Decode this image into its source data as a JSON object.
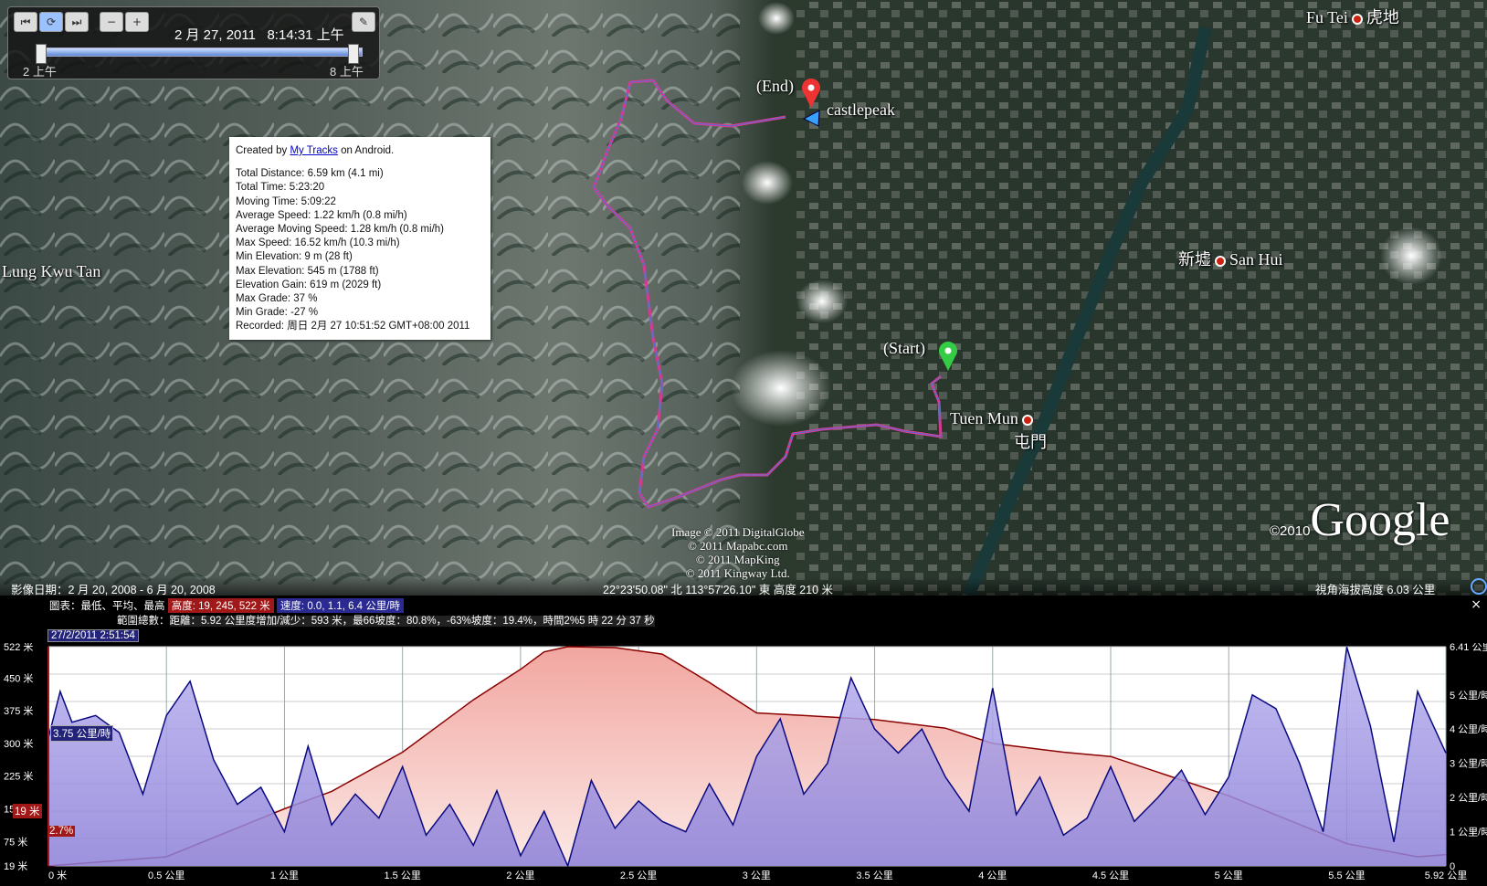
{
  "player": {
    "date_text": "2 月 27, 2011",
    "time_text": "8:14:31 上午",
    "range_start": "2 上午",
    "range_end": "8 上午"
  },
  "places": {
    "fu_tei": "Fu Tei",
    "fu_tei_zh": "虎地",
    "end_label": "(End)",
    "castlepeak": "castlepeak",
    "lung_kwu_tan": "Lung Kwu Tan",
    "san_hui_zh": "新墟",
    "san_hui": "San Hui",
    "start_label": "(Start)",
    "tuen_mun": "Tuen Mun",
    "tuen_mun_zh": "屯門"
  },
  "balloon": {
    "created_by_prefix": "Created by",
    "created_by_link": "My Tracks",
    "created_by_suffix": "on Android.",
    "stats": [
      "Total Distance: 6.59 km (4.1 mi)",
      "Total Time: 5:23:20",
      "Moving Time: 5:09:22",
      "Average Speed: 1.22 km/h (0.8 mi/h)",
      "Average Moving Speed: 1.28 km/h (0.8 mi/h)",
      "Max Speed: 16.52 km/h (10.3 mi/h)",
      "Min Elevation: 9 m (28 ft)",
      "Max Elevation: 545 m (1788 ft)",
      "Elevation Gain: 619 m (2029 ft)",
      "Max Grade: 37 %",
      "Min Grade: -27 %",
      "Recorded: 周日 2月 27 10:51:52 GMT+08:00 2011"
    ]
  },
  "copyright": [
    "Image © 2011 DigitalGlobe",
    "© 2011 Mapabc.com",
    "© 2011 MapKing",
    "© 2011 Kingway Ltd."
  ],
  "google": {
    "year": "©2010",
    "logo": "Google"
  },
  "statusbar": {
    "imagery_date": "影像日期：2 月 20, 2008 - 6 月 20, 2008",
    "coords": "22°23'50.08\" 北    113°57'26.10\" 東    高度  210 米",
    "eye_alt": "視角海拔高度      6.03 公里"
  },
  "profile": {
    "legend_prefix": "圖表：最低、平均、最高",
    "elev_tag": "高度: 19, 245, 522 米",
    "speed_tag": "速度: 0.0, 1.1, 6.4 公里/時",
    "range_stats_prefix": "範圍總數：",
    "range_stats": "距離：5.92 公里度增加/減少：593 米，最66坡度：80.8%，-63%坡度：19.4%，時間2%5 時 22 分 37 秒",
    "timestamp": "27/2/2011 2:51:54",
    "cursor_speed": "3.75 公里/時",
    "cursor_elev": "19 米",
    "cursor_grade": "2.7%",
    "close": "×",
    "left_ticks": [
      "522 米",
      "450 米",
      "375 米",
      "300 米",
      "225 米",
      "150 米",
      "75 米",
      "19 米"
    ],
    "right_ticks": [
      "6.41 公里",
      "5 公里/時",
      "4 公里/時",
      "3 公里/時",
      "2 公里/時",
      "1 公里/時",
      "0"
    ],
    "x_ticks": [
      "0 米",
      "0.5 公里",
      "1 公里",
      "1.5 公里",
      "2 公里",
      "2.5 公里",
      "3 公里",
      "3.5 公里",
      "4 公里",
      "4.5 公里",
      "5 公里",
      "5.5 公里",
      "5.92 公里"
    ]
  },
  "chart_data": {
    "type": "area",
    "x_unit": "公里",
    "xlim": [
      0,
      5.92
    ],
    "series": [
      {
        "axis": "left",
        "unit": "米",
        "color": "#8b0000",
        "x": [
          0,
          0.5,
          1,
          1.2,
          1.5,
          1.8,
          2,
          2.1,
          2.2,
          2.4,
          2.6,
          2.8,
          3,
          3.5,
          3.8,
          4,
          4.3,
          4.5,
          5,
          5.5,
          5.8,
          5.92
        ],
        "values": [
          19,
          40,
          150,
          190,
          280,
          400,
          470,
          510,
          522,
          520,
          505,
          440,
          370,
          355,
          335,
          300,
          280,
          270,
          180,
          70,
          40,
          45
        ]
      },
      {
        "axis": "right",
        "unit": "公里/時",
        "color": "#0a0a80",
        "x": [
          0,
          0.05,
          0.1,
          0.2,
          0.3,
          0.4,
          0.5,
          0.6,
          0.7,
          0.8,
          0.9,
          1,
          1.1,
          1.2,
          1.3,
          1.4,
          1.5,
          1.6,
          1.7,
          1.8,
          1.9,
          2,
          2.1,
          2.2,
          2.3,
          2.4,
          2.5,
          2.6,
          2.7,
          2.8,
          2.9,
          3,
          3.1,
          3.2,
          3.3,
          3.4,
          3.5,
          3.6,
          3.7,
          3.8,
          3.9,
          4,
          4.1,
          4.2,
          4.3,
          4.4,
          4.5,
          4.6,
          4.7,
          4.8,
          4.9,
          5,
          5.1,
          5.2,
          5.3,
          5.4,
          5.5,
          5.6,
          5.7,
          5.8,
          5.92
        ],
        "values": [
          3.75,
          5.1,
          4.2,
          4.4,
          3.9,
          2.1,
          4.4,
          5.4,
          3.1,
          1.8,
          2.3,
          1.0,
          3.5,
          1.2,
          2.1,
          1.4,
          2.9,
          0.9,
          1.8,
          0.6,
          2.2,
          0.3,
          1.6,
          0.0,
          2.5,
          1.1,
          1.9,
          1.3,
          1.0,
          2.4,
          1.2,
          3.2,
          4.3,
          2.1,
          3.0,
          5.5,
          4.0,
          3.3,
          4.0,
          2.6,
          1.6,
          5.2,
          1.5,
          2.6,
          0.9,
          1.4,
          2.9,
          1.3,
          2.0,
          2.8,
          1.5,
          2.6,
          5.0,
          4.6,
          3.0,
          1.0,
          6.4,
          4.1,
          0.7,
          5.1,
          3.3
        ]
      }
    ],
    "left_ylim": [
      19,
      522
    ],
    "right_ylim": [
      0,
      6.41
    ]
  }
}
